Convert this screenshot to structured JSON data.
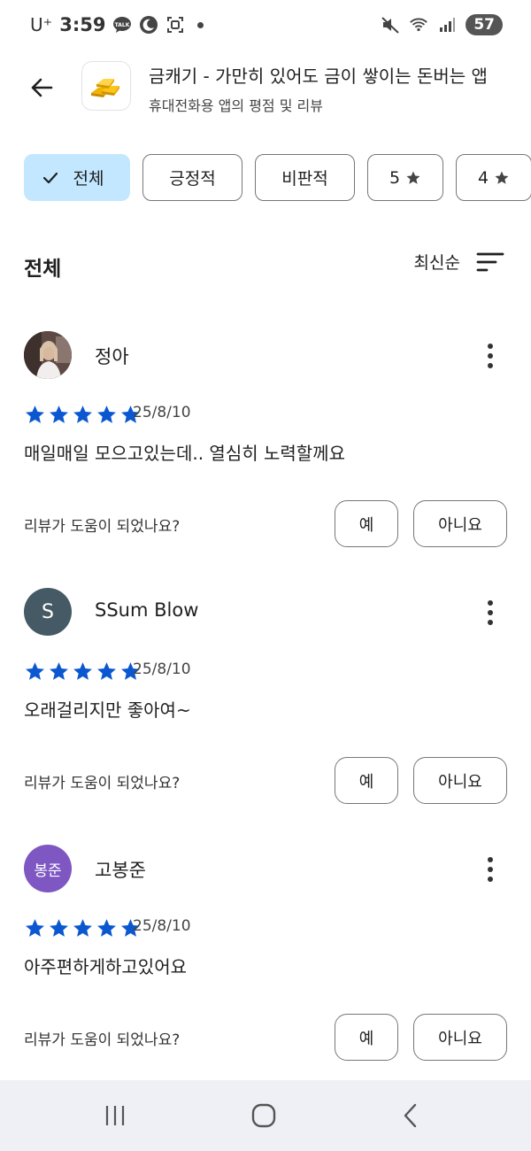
{
  "status_bar": {
    "carrier": "U⁺",
    "time": "3:59",
    "battery": "57"
  },
  "header": {
    "app_title": "금캐기 - 가만히 있어도 금이 쌓이는 돈버는 앱",
    "subtitle": "휴대전화용 앱의 평점 및 리뷰"
  },
  "filters": {
    "all": "전체",
    "positive": "긍정적",
    "critical": "비판적",
    "five": "5",
    "four": "4"
  },
  "list": {
    "title": "전체",
    "sort_label": "최신순",
    "helpful_question": "리뷰가 도움이 되었나요?",
    "yes_label": "예",
    "no_label": "아니요"
  },
  "reviews": [
    {
      "author": "정아",
      "rating": 5,
      "date": "25/8/10",
      "content": "매일매일 모으고있는데.. 열심히 노력할께요",
      "avatar_type": "photo"
    },
    {
      "author": "SSum Blow",
      "rating": 5,
      "date": "25/8/10",
      "content": "오래걸리지만 좋아여~",
      "avatar_text": "S",
      "avatar_color": "#455a64"
    },
    {
      "author": "고봉준",
      "rating": 5,
      "date": "25/8/10",
      "content": "아주편하게하고있어요",
      "avatar_text": "봉준",
      "avatar_color": "#7e57c2"
    }
  ],
  "colors": {
    "star": "#0b57d0",
    "chip_selected": "#c2e7ff"
  },
  "icons": [
    "back-arrow-icon",
    "gold-bars-icon",
    "check-icon",
    "star-icon",
    "sort-icon",
    "more-vert-icon",
    "recents-icon",
    "home-icon",
    "nav-back-icon"
  ]
}
